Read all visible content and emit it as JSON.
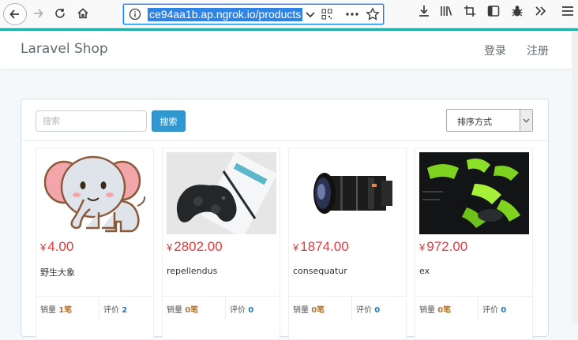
{
  "browser": {
    "url": "ce94aa1b.ap.ngrok.io/products"
  },
  "navbar": {
    "brand": "Laravel Shop",
    "login": "登录",
    "register": "注册"
  },
  "filter": {
    "search_placeholder": "搜索",
    "search_button": "搜索",
    "sort_label": "排序方式"
  },
  "products": [
    {
      "currency": "¥",
      "price": "4.00",
      "title": "野生大象",
      "sold_label": "销量",
      "sold": "1笔",
      "review_label": "评价",
      "reviews": "2",
      "image": "elephant-cartoon"
    },
    {
      "currency": "¥",
      "price": "2802.00",
      "title": "repellendus",
      "sold_label": "销量",
      "sold": "0笔",
      "review_label": "评价",
      "reviews": "0",
      "image": "game-controller"
    },
    {
      "currency": "¥",
      "price": "1874.00",
      "title": "consequatur",
      "sold_label": "销量",
      "sold": "0笔",
      "review_label": "评价",
      "reviews": "0",
      "image": "camera-lens"
    },
    {
      "currency": "¥",
      "price": "972.00",
      "title": "ex",
      "sold_label": "销量",
      "sold": "0笔",
      "review_label": "评价",
      "reviews": "0",
      "image": "green-controller-parts"
    }
  ],
  "colors": {
    "accent": "#1fb1a6",
    "price": "#e4393c",
    "button": "#3097d1"
  }
}
